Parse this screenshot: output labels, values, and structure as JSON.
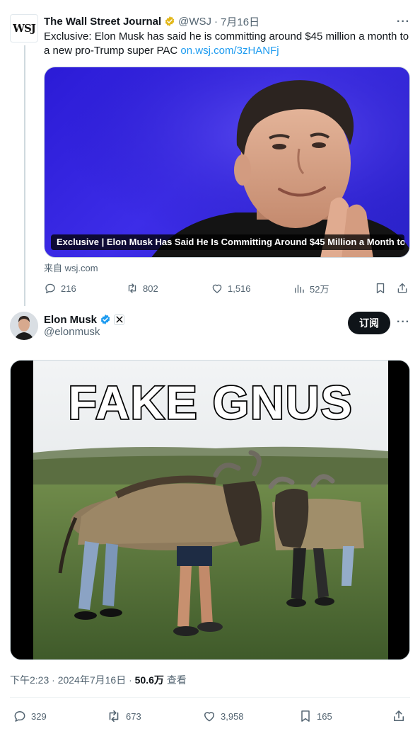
{
  "quoted_tweet": {
    "author_name": "The Wall Street Journal",
    "avatar_text": "WSJ",
    "handle": "@WSJ",
    "separator": "·",
    "date": "7月16日",
    "text": "Exclusive: Elon Musk has said he is committing around $45 million a month to a new pro-Trump super PAC",
    "link": "on.wsj.com/3zHANFj",
    "card_title": "Exclusive | Elon Musk Has Said He Is Committing Around $45 Million a Month to ...",
    "source": "来自 wsj.com",
    "replies": "216",
    "reposts": "802",
    "likes": "1,516",
    "views": "52万"
  },
  "main_tweet": {
    "author_name": "Elon Musk",
    "handle": "@elonmusk",
    "subscribe_label": "订阅",
    "image_text": "FAKE GNUS",
    "time": "下午2:23",
    "date": "2024年7月16日",
    "views_count": "50.6万",
    "views_label": "查看",
    "meta_separator": " · ",
    "replies": "329",
    "reposts": "673",
    "likes": "3,958",
    "bookmarks": "165"
  },
  "colors": {
    "text_primary": "#0f1419",
    "text_secondary": "#536471",
    "link": "#1d9bf0",
    "verified_blue": "#1d9bf0",
    "verified_gold": "#e2b719",
    "border": "#cfd9de"
  }
}
